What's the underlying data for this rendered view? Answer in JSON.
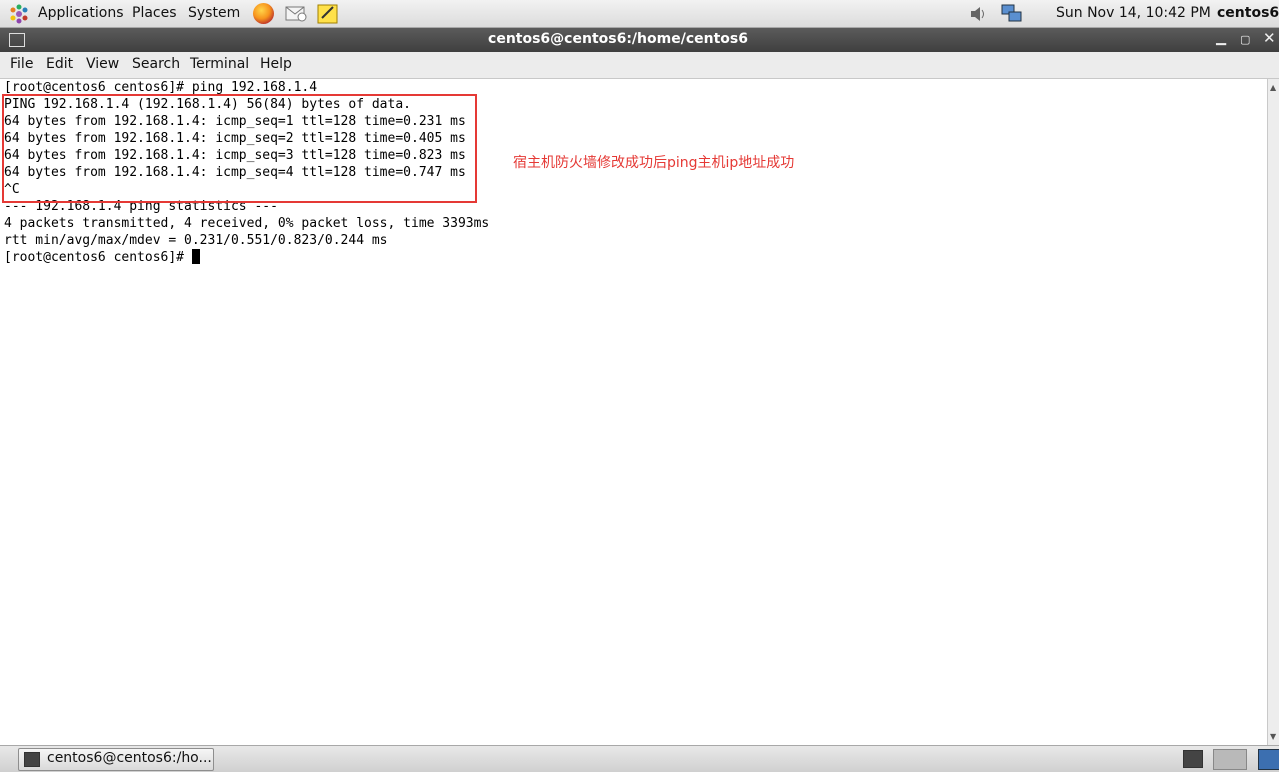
{
  "top_panel": {
    "menus": [
      "Applications",
      "Places",
      "System"
    ],
    "clock": "Sun Nov 14, 10:42 PM",
    "user": "centos6",
    "icons": [
      "gnome-foot-icon",
      "firefox-icon",
      "mail-icon",
      "notes-icon",
      "volume-icon",
      "network-icon"
    ]
  },
  "window": {
    "title": "centos6@centos6:/home/centos6",
    "buttons": [
      "minimize",
      "maximize",
      "close"
    ]
  },
  "menubar": [
    "File",
    "Edit",
    "View",
    "Search",
    "Terminal",
    "Help"
  ],
  "terminal": {
    "lines": [
      "[root@centos6 centos6]# ping 192.168.1.4",
      "PING 192.168.1.4 (192.168.1.4) 56(84) bytes of data.",
      "64 bytes from 192.168.1.4: icmp_seq=1 ttl=128 time=0.231 ms",
      "64 bytes from 192.168.1.4: icmp_seq=2 ttl=128 time=0.405 ms",
      "64 bytes from 192.168.1.4: icmp_seq=3 ttl=128 time=0.823 ms",
      "64 bytes from 192.168.1.4: icmp_seq=4 ttl=128 time=0.747 ms",
      "^C",
      "--- 192.168.1.4 ping statistics ---",
      "4 packets transmitted, 4 received, 0% packet loss, time 3393ms",
      "rtt min/avg/max/mdev = 0.231/0.551/0.823/0.244 ms"
    ],
    "prompt": "[root@centos6 centos6]# "
  },
  "annotation": {
    "text": "宿主机防火墙修改成功后ping主机ip地址成功",
    "color": "#e53935"
  },
  "taskbar": {
    "window_button": "centos6@centos6:/ho..."
  }
}
